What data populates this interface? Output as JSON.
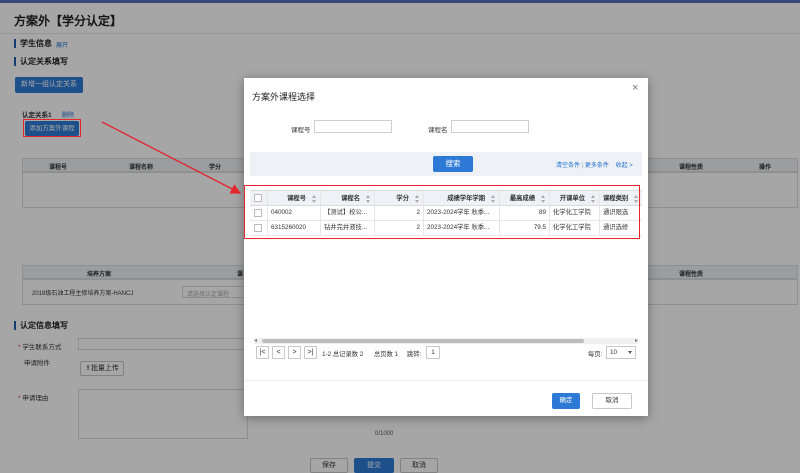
{
  "page": {
    "title": "方案外【学分认定】",
    "student_section": {
      "title": "学生信息",
      "expand_link": "展开"
    },
    "relation_section": {
      "title": "认定关系填写",
      "add_group_button": "新增一组认定关系",
      "relation_label": "认定关系1",
      "delete_link": "删除",
      "add_course_button": "添加方案外课程",
      "table_headers": [
        "课程号",
        "课程名称",
        "学分",
        "课程性质",
        "操作"
      ],
      "plan_headers": [
        "培养方案",
        "课",
        "课程性质"
      ],
      "plan_value": "2018级石油工程主修培养方案-HANCJ",
      "plan_select_placeholder": "请选择认定课程"
    },
    "info_section": {
      "title": "认定信息填写",
      "contact_label": "学生联系方式",
      "attachment_label": "申请附件",
      "upload_button": "批量上传",
      "reason_label": "申请理由",
      "char_count": "0/1000"
    },
    "footer": {
      "save": "保存",
      "submit": "提交",
      "cancel": "取消"
    }
  },
  "modal": {
    "title": "方案外课程选择",
    "close": "×",
    "course_no_label": "课程号",
    "course_no_value": "",
    "course_name_label": "课程名",
    "course_name_value": "",
    "search_button": "搜索",
    "clear_link": "清空条件",
    "sep": "|",
    "more_link": "更多条件",
    "collapse_link": "收起 >",
    "columns": [
      "课程号",
      "课程名",
      "学分",
      "成绩学年学期",
      "最高成绩",
      "开课单位",
      "课程类别"
    ],
    "rows": [
      {
        "no": "040002",
        "name": "【测试】校公...",
        "credit": "2",
        "term": "2023-2024学年 秋季...",
        "score": "89",
        "unit": "化学化工学院",
        "type": "通识限选"
      },
      {
        "no": "6315260020",
        "name": "钻井完井液技...",
        "credit": "2",
        "term": "2023-2024学年 秋季...",
        "score": "79.5",
        "unit": "化学化工学院",
        "type": "通识选修"
      }
    ],
    "pager": {
      "first": "|<",
      "prev": "<",
      "next": ">",
      "last": ">|",
      "summary": "1-2 总记录数 2",
      "total_pages": "总页数 1",
      "jump_label": "跳转:",
      "jump_value": "1",
      "page_size_label": "每页:",
      "page_size": "10"
    },
    "ok_button": "确定",
    "cancel_button": "取消"
  },
  "colors": {
    "primary": "#2d7ad6",
    "highlight": "#e3272d",
    "header_bg": "#eef1f6"
  }
}
